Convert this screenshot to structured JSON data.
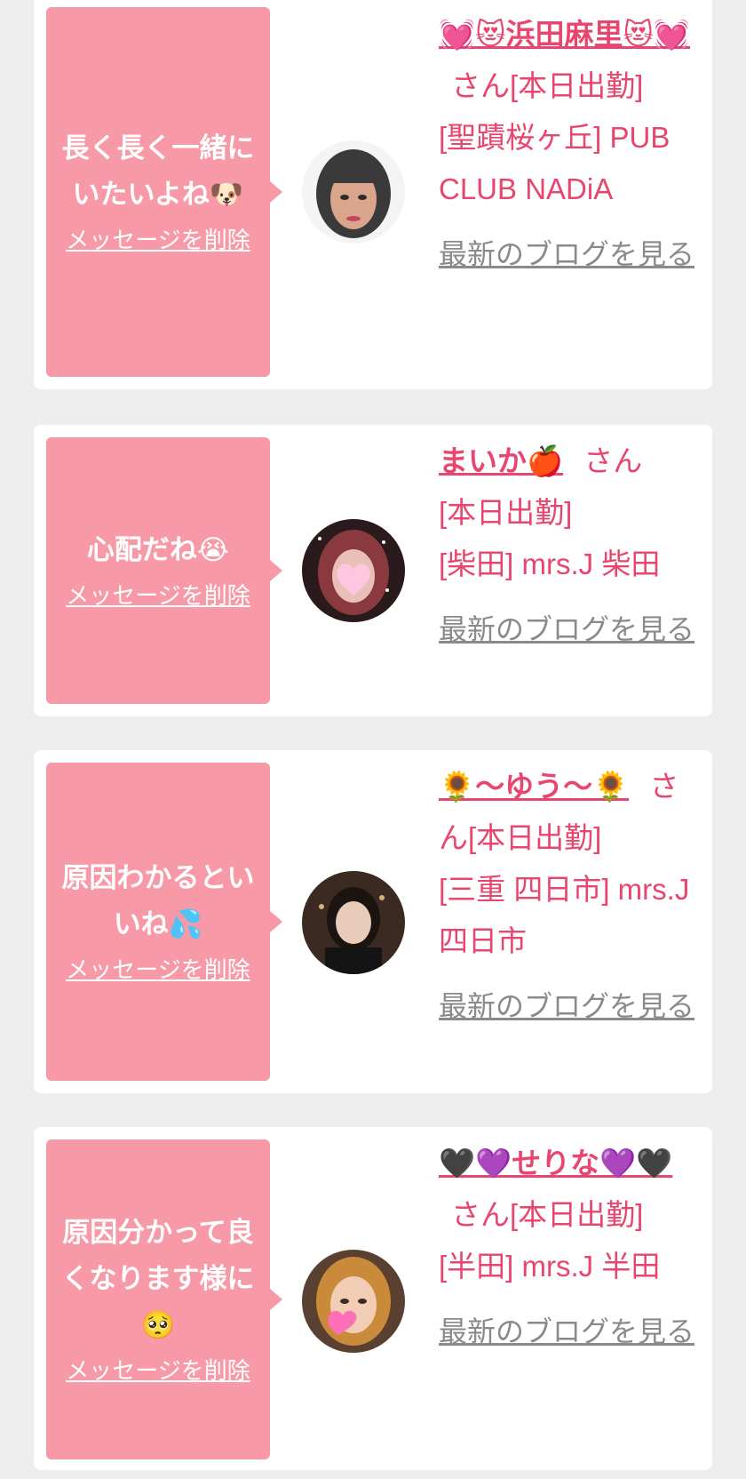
{
  "delete_label": "メッセージを削除",
  "san_label": "さん",
  "blog_label": "最新のブログを見る",
  "colors": {
    "bubble": "#f799a7",
    "accent": "#e8466e",
    "link_gray": "#8a8a8a",
    "background": "#eeeeee"
  },
  "messages": [
    {
      "text": "長く長く一緒に\nいたいよね🐶",
      "name": "💓😻浜田麻里😻💓",
      "status": "[本日出勤]",
      "shop": "[聖蹟桜ヶ丘] PUB CLUB NADiA",
      "avatar_icon": "avatar-photo"
    },
    {
      "text": "心配だね😭",
      "name": "まいか🍎",
      "status": "[本日出勤]",
      "shop": "[柴田] mrs.J 柴田",
      "avatar_icon": "avatar-photo"
    },
    {
      "text": "原因わかるとい\nいね💦",
      "name": "🌻〜ゆう〜🌻",
      "status": "[本日出勤]",
      "shop": "[三重 四日市] mrs.J 四日市",
      "avatar_icon": "avatar-photo"
    },
    {
      "text": "原因分かって良\nくなります様に\n🥺",
      "name": "🖤💜せりな💜🖤",
      "status": "[本日出勤]",
      "shop": "[半田] mrs.J 半田",
      "avatar_icon": "avatar-photo"
    }
  ]
}
